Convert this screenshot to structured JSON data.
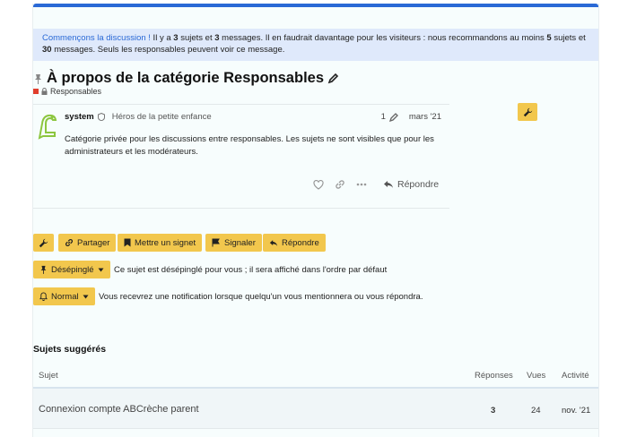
{
  "notice": {
    "link": "Commençons la discussion !",
    "t1": " Il y a ",
    "topics": "3",
    "t2": " sujets et ",
    "messages": "3",
    "t3": " messages. Il en faudrait davantage pour les visiteurs : nous recommandons au moins ",
    "min_topics": "5",
    "t4": " sujets et ",
    "min_messages": "30",
    "t5": " messages. Seuls les responsables peuvent voir ce message."
  },
  "topic": {
    "title": "À propos de la catégorie Responsables",
    "category": "Responsables",
    "category_color": "#e03e2d"
  },
  "post": {
    "username": "system",
    "user_title": "Héros de la petite enfance",
    "edits": "1",
    "date": "mars '21",
    "body": "Catégorie privée pour les discussions entre responsables. Les sujets ne sont visibles que pour les administrateurs et les modérateurs.",
    "reply_label": "Répondre"
  },
  "footer_buttons": {
    "share": "Partager",
    "bookmark": "Mettre un signet",
    "flag": "Signaler",
    "reply": "Répondre"
  },
  "pin": {
    "label": "Désépinglé",
    "desc": "Ce sujet est désépinglé pour vous ; il sera affiché dans l'ordre par défaut"
  },
  "notification": {
    "label": "Normal",
    "desc": "Vous recevrez une notification lorsque quelqu'un vous mentionnera ou vous répondra."
  },
  "suggested": {
    "heading": "Sujets suggérés",
    "columns": {
      "topic": "Sujet",
      "replies": "Réponses",
      "views": "Vues",
      "activity": "Activité"
    },
    "rows": [
      {
        "title": "Connexion compte ABCrèche parent",
        "replies": "3",
        "views": "24",
        "activity": "nov. '21"
      }
    ]
  },
  "colors": {
    "accent": "#2a69d6",
    "button": "#f2c74d",
    "notice_bg": "#dfe9fb"
  }
}
